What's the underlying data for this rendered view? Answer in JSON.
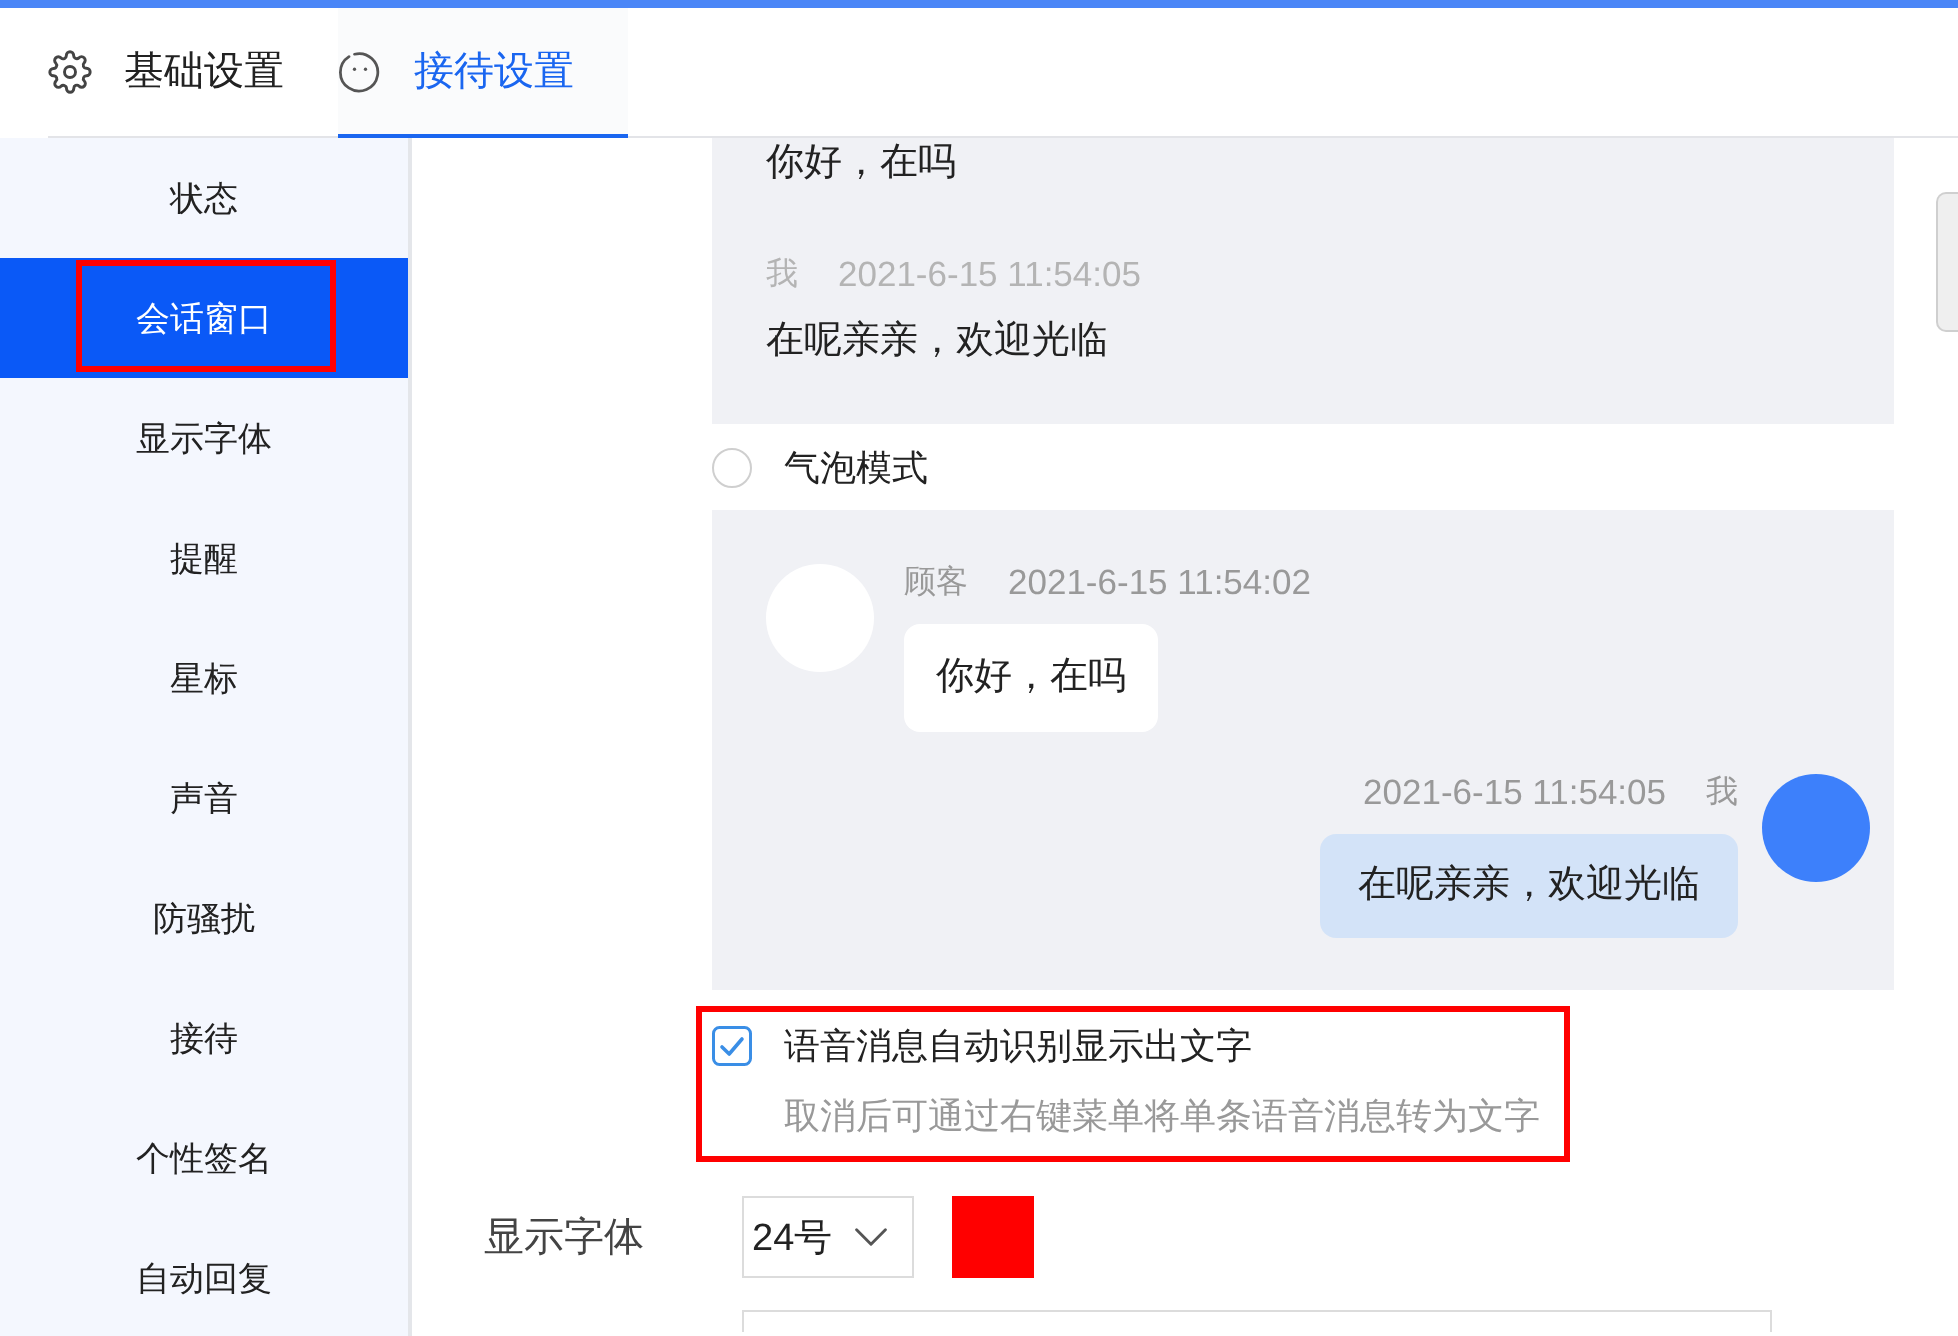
{
  "header": {
    "tabs": [
      {
        "kind": "gear",
        "label": "基础设置",
        "selected": false
      },
      {
        "kind": "face",
        "label": "接待设置",
        "selected": true
      }
    ]
  },
  "sidebar": {
    "items": [
      {
        "label": "状态",
        "selected": false,
        "highlighted": false
      },
      {
        "label": "会话窗口",
        "selected": true,
        "highlighted": true
      },
      {
        "label": "显示字体",
        "selected": false,
        "highlighted": false
      },
      {
        "label": "提醒",
        "selected": false,
        "highlighted": false
      },
      {
        "label": "星标",
        "selected": false,
        "highlighted": false
      },
      {
        "label": "声音",
        "selected": false,
        "highlighted": false
      },
      {
        "label": "防骚扰",
        "selected": false,
        "highlighted": false
      },
      {
        "label": "接待",
        "selected": false,
        "highlighted": false
      },
      {
        "label": "个性签名",
        "selected": false,
        "highlighted": false
      },
      {
        "label": "自动回复",
        "selected": false,
        "highlighted": false
      }
    ]
  },
  "message_display": {
    "simple_preview": {
      "messages": [
        {
          "text": "你好，在吗"
        },
        {
          "sender": "我",
          "time": "2021-6-15 11:54:05",
          "text": "在呢亲亲，欢迎光临"
        }
      ]
    },
    "bubble_mode": {
      "label": "气泡模式",
      "selected": false
    },
    "bubble_preview": {
      "messages": [
        {
          "kind": "received",
          "sender": "顾客",
          "time": "2021-6-15 11:54:02",
          "text": "你好，在吗"
        },
        {
          "kind": "sent",
          "sender": "我",
          "time": "2021-6-15 11:54:05",
          "text": "在呢亲亲，欢迎光临"
        }
      ]
    }
  },
  "voice_to_text": {
    "label": "语音消息自动识别显示出文字",
    "hint": "取消后可通过右键菜单将单条语音消息转为文字",
    "checked": true,
    "highlighted": true
  },
  "font_setting": {
    "label": "显示字体",
    "size": "24号",
    "color": "#ff0000"
  }
}
